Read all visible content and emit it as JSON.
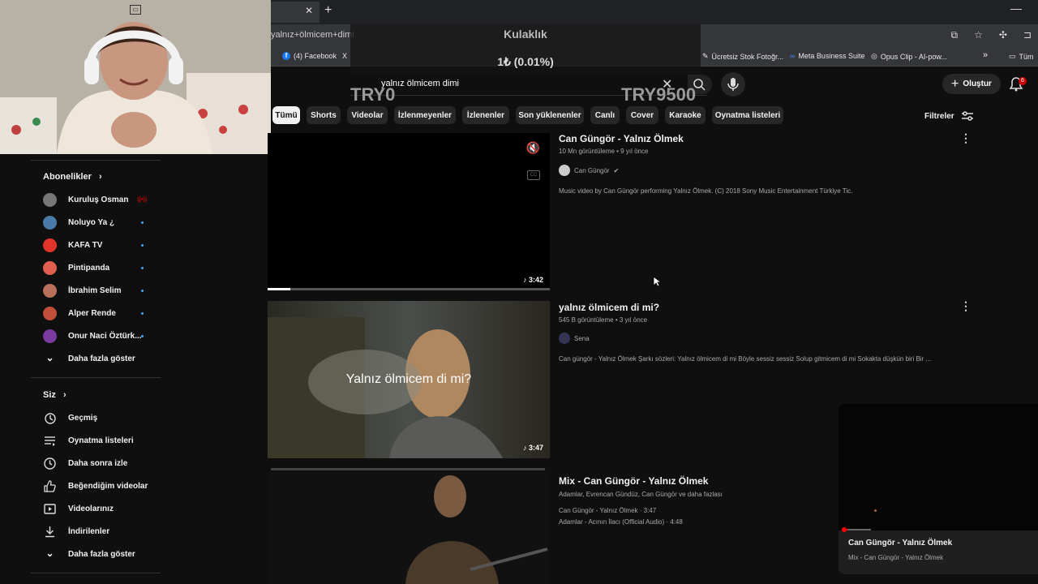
{
  "browser": {
    "address_text": "yalnız+ölmicem+dimi",
    "bookmarks": [
      "(4) Facebook",
      "X",
      "Ücretsiz Stok Fotoğr...",
      "Meta Business Suite",
      "Opus Clip - AI-pow...",
      "»",
      "Tüm"
    ]
  },
  "overlay": {
    "title": "Kulaklık",
    "amount": "1₺ (0.01%)",
    "left_label": "TRY0",
    "right_label": "TRY9500"
  },
  "header": {
    "search_value": "yalnız ölmicem dimi",
    "create_label": "Oluştur",
    "notification_count": "6"
  },
  "chips": [
    "Tümü",
    "Shorts",
    "Videolar",
    "İzlenmeyenler",
    "İzlenenler",
    "Son yüklenenler",
    "Canlı",
    "Cover",
    "Karaoke",
    "Oynatma listeleri"
  ],
  "filters_label": "Filtreler",
  "sidebar": {
    "subscriptions_title": "Abonelikler",
    "channels": [
      {
        "name": "Kuruluş Osman",
        "color": "#777777"
      },
      {
        "name": "Noluyo Ya ¿",
        "color": "#4a7aa8"
      },
      {
        "name": "KAFA TV",
        "color": "#e2342b"
      },
      {
        "name": "Pintipanda",
        "color": "#e06050"
      },
      {
        "name": "İbrahim Selim",
        "color": "#b8705a"
      },
      {
        "name": "Alper Rende",
        "color": "#c0503a"
      },
      {
        "name": "Onur Naci Öztürk...",
        "color": "#7a3aa0"
      }
    ],
    "show_more": "Daha fazla göster",
    "you_title": "Siz",
    "you_items": [
      {
        "label": "Geçmiş",
        "icon": "history-icon"
      },
      {
        "label": "Oynatma listeleri",
        "icon": "playlists-icon"
      },
      {
        "label": "Daha sonra izle",
        "icon": "clock-icon"
      },
      {
        "label": "Beğendiğim videolar",
        "icon": "thumbs-up-icon"
      },
      {
        "label": "Videolarınız",
        "icon": "video-icon"
      },
      {
        "label": "İndirilenler",
        "icon": "download-icon"
      },
      {
        "label": "Daha fazla göster",
        "icon": "chevron-down-icon"
      }
    ]
  },
  "results": [
    {
      "title": "Can Güngör - Yalnız Ölmek",
      "meta": "10 Mn görüntüleme • 9 yıl önce",
      "channel": "Can Güngör",
      "description": "Music video by Can Güngör performing Yalnız Ölmek. (C) 2018 Sony Music Entertainment Türkiye Tic.",
      "duration": "3:42"
    },
    {
      "title": "yalnız ölmicem di mi?",
      "meta": "545 B görüntüleme • 3 yıl önce",
      "channel": "Sena",
      "description": "Can güngör - Yalnız Ölmek Şarkı sözleri: Yalnız ölmicem di mi Böyle sessiz sessiz Solup gitmicem di mi Sokakta düşkün biri Bir ...",
      "duration": "3:47",
      "thumb_text": "Yalnız ölmicem di mi?"
    },
    {
      "title": "Mix - Can Güngör - Yalnız Ölmek",
      "meta": "Adamlar, Evrencan Gündüz, Can Güngör ve daha fazlası",
      "line1": "Can Güngör - Yalnız Ölmek · 3:47",
      "line2": "Adamlar - Acının İlacı (Official Audio) · 4:48"
    }
  ],
  "mini_player": {
    "title": "Can Güngör - Yalnız Ölmek",
    "subtitle": "Mix - Can Güngör - Yalnız Ölmek"
  }
}
